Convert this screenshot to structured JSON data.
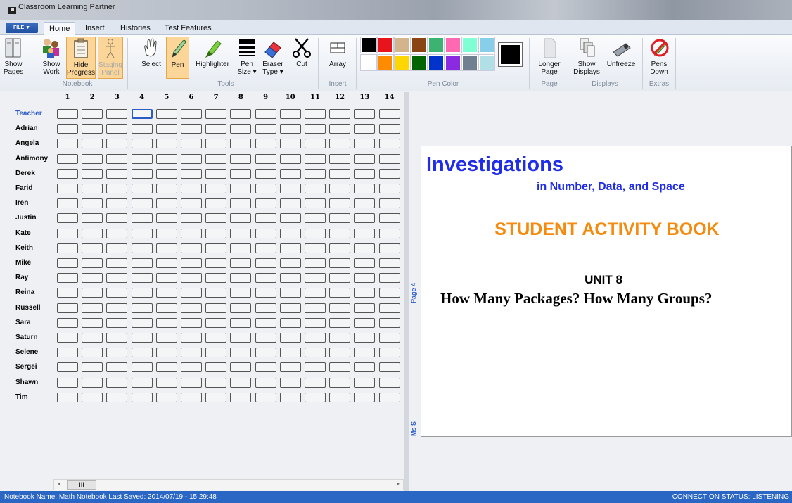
{
  "app": {
    "title": "Classroom Learning Partner"
  },
  "ribbon": {
    "file_label": "FILE ▼",
    "tabs": [
      "Home",
      "Insert",
      "Histories",
      "Test Features"
    ],
    "buttons": {
      "show_pages": [
        "Show",
        "Pages"
      ],
      "show_work": [
        "Show",
        "Work"
      ],
      "hide_progress": [
        "Hide",
        "Progress"
      ],
      "staging_panel": [
        "Staging",
        "Panel"
      ],
      "select": "Select",
      "pen": "Pen",
      "highlighter": "Highlighter",
      "pen_size": [
        "Pen",
        "Size ▾"
      ],
      "eraser_type": [
        "Eraser",
        "Type ▾"
      ],
      "cut": "Cut",
      "array": "Array",
      "longer_page": [
        "Longer",
        "Page"
      ],
      "show_displays": [
        "Show",
        "Displays"
      ],
      "unfreeze": "Unfreeze",
      "pens_down": [
        "Pens",
        "Down"
      ]
    },
    "groups": [
      "Notebook",
      "Tools",
      "Insert",
      "Pen Color",
      "Page",
      "Displays",
      "Extras"
    ],
    "pen_colors": {
      "top": [
        "#000000",
        "#e8141c",
        "#d3b48c",
        "#8b4513",
        "#3cb371",
        "#ff69b4",
        "#7fffd4",
        "#87ceeb"
      ],
      "bottom": [
        "#ffffff",
        "#ff8c00",
        "#ffd700",
        "#006400",
        "#0033cc",
        "#8a2be2",
        "#708090",
        "#b0e0e6"
      ],
      "selected": "#000000"
    }
  },
  "grid": {
    "columns": [
      "1",
      "2",
      "3",
      "4",
      "5",
      "6",
      "7",
      "8",
      "9",
      "10",
      "11",
      "12",
      "13",
      "14"
    ],
    "students": [
      "Teacher",
      "Adrian",
      "Angela",
      "Antimony",
      "Derek",
      "Farid",
      "Iren",
      "Justin",
      "Kate",
      "Keith",
      "Mike",
      "Ray",
      "Reina",
      "Russell",
      "Sara",
      "Saturn",
      "Selene",
      "Sergei",
      "Shawn",
      "Tim"
    ],
    "selected_cell": {
      "row": 0,
      "col": 3
    },
    "scroll_thumb": "III"
  },
  "page": {
    "page_label": "Page 4",
    "owner_label": "Ms S",
    "heading": "Investigations",
    "subheading": "in Number, Data, and Space",
    "book": "STUDENT ACTIVITY BOOK",
    "unit": "UNIT 8",
    "unit_title": "How Many Packages? How Many Groups?"
  },
  "status": {
    "notebook": "Notebook Name:  Math Notebook     Last Saved:  2014/07/19 - 15:29:48",
    "connection": "CONNECTION STATUS:  LISTENING"
  },
  "colors": {
    "accent": "#2a66c4",
    "highlight": "#fbd698",
    "title_blue": "#1f2ce8",
    "book_orange": "#f58a0c"
  }
}
